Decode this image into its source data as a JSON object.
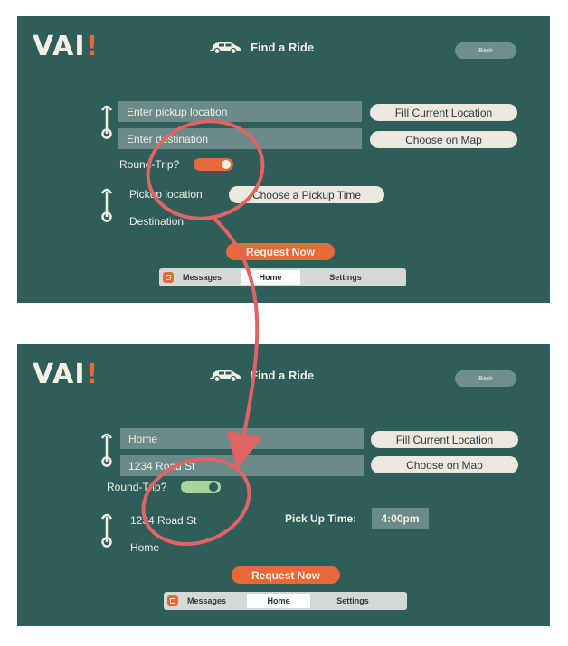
{
  "app": {
    "logo": "VAI",
    "logo_accent": "!"
  },
  "colors": {
    "panel": "#2f5d5a",
    "accent": "#e8683a",
    "toggle_on": "#a9d59a",
    "annotation": "#e06463"
  },
  "top": {
    "title": "Find a Ride",
    "back": "Back",
    "pickup_placeholder": "Enter pickup location",
    "destination_placeholder": "Enter destination",
    "fill_current": "Fill Current Location",
    "choose_map": "Choose on Map",
    "round_trip": "Round-Trip?",
    "round_trip_state": "off",
    "pickup_label": "Pickup location",
    "destination_label": "Destination",
    "choose_time": "Choose a Pickup Time",
    "request": "Request Now",
    "tabs": {
      "messages": "Messages",
      "home": "Home",
      "settings": "Settings"
    }
  },
  "bottom": {
    "title": "Find a Ride",
    "back": "Back",
    "pickup_value": "Home",
    "destination_value": "1234 Road St",
    "fill_current": "Fill Current Location",
    "choose_map": "Choose on Map",
    "round_trip": "Round-Trip?",
    "round_trip_state": "on",
    "return_pickup": "1234 Road St",
    "return_destination": "Home",
    "pickup_time_label": "Pick Up Time:",
    "pickup_time": "4:00pm",
    "request": "Request Now",
    "tabs": {
      "messages": "Messages",
      "home": "Home",
      "settings": "Settings"
    }
  }
}
